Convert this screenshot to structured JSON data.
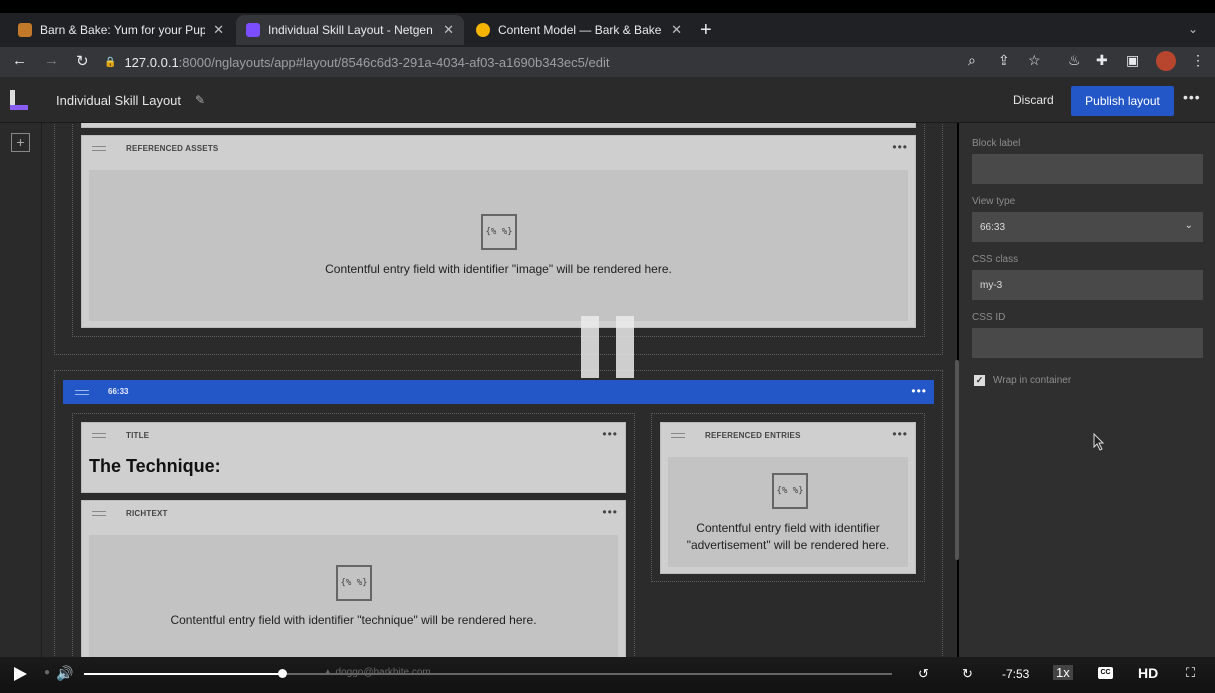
{
  "browser": {
    "tabs": [
      {
        "title": "Barn & Bake: Yum for your Pup",
        "favicon_color": "#c27a2a"
      },
      {
        "title": "Individual Skill Layout - Netgen",
        "favicon_color": "#7c4dff"
      },
      {
        "title": "Content Model — Bark & Bake",
        "favicon_color": "#f4b400"
      }
    ],
    "url_host": "127.0.0.1",
    "url_rest": ":8000/nglayouts/app#layout/8546c6d3-291a-4034-af03-a1690b343ec5/edit"
  },
  "app": {
    "layout_title": "Individual Skill Layout",
    "discard_label": "Discard",
    "publish_label": "Publish layout"
  },
  "canvas": {
    "referenced_assets": {
      "label": "REFERENCED ASSETS",
      "placeholder": "{% %}",
      "message": "Contentful entry field with identifier \"image\" will be rendered here."
    },
    "row": {
      "label": "66:33"
    },
    "title_block": {
      "label": "TITLE",
      "text": "The Technique:"
    },
    "richtext_block": {
      "label": "RICHTEXT",
      "placeholder": "{% %}",
      "message": "Contentful entry field with identifier \"technique\" will be rendered here."
    },
    "referenced_entries": {
      "label": "REFERENCED ENTRIES",
      "placeholder": "{% %}",
      "message_line1": "Contentful entry field with identifier",
      "message_line2": "\"advertisement\" will be rendered here."
    }
  },
  "panel": {
    "block_label_label": "Block label",
    "block_label_value": "",
    "view_type_label": "View type",
    "view_type_value": "66:33",
    "css_class_label": "CSS class",
    "css_class_value": "my-3",
    "css_id_label": "CSS ID",
    "css_id_value": "",
    "wrap_label": "Wrap in container",
    "wrap_checked": true
  },
  "player": {
    "remaining": "-7:53",
    "speed": "1x",
    "cc": "CC",
    "hd": "HD",
    "debug_user": "doggo@barkbite.com"
  }
}
